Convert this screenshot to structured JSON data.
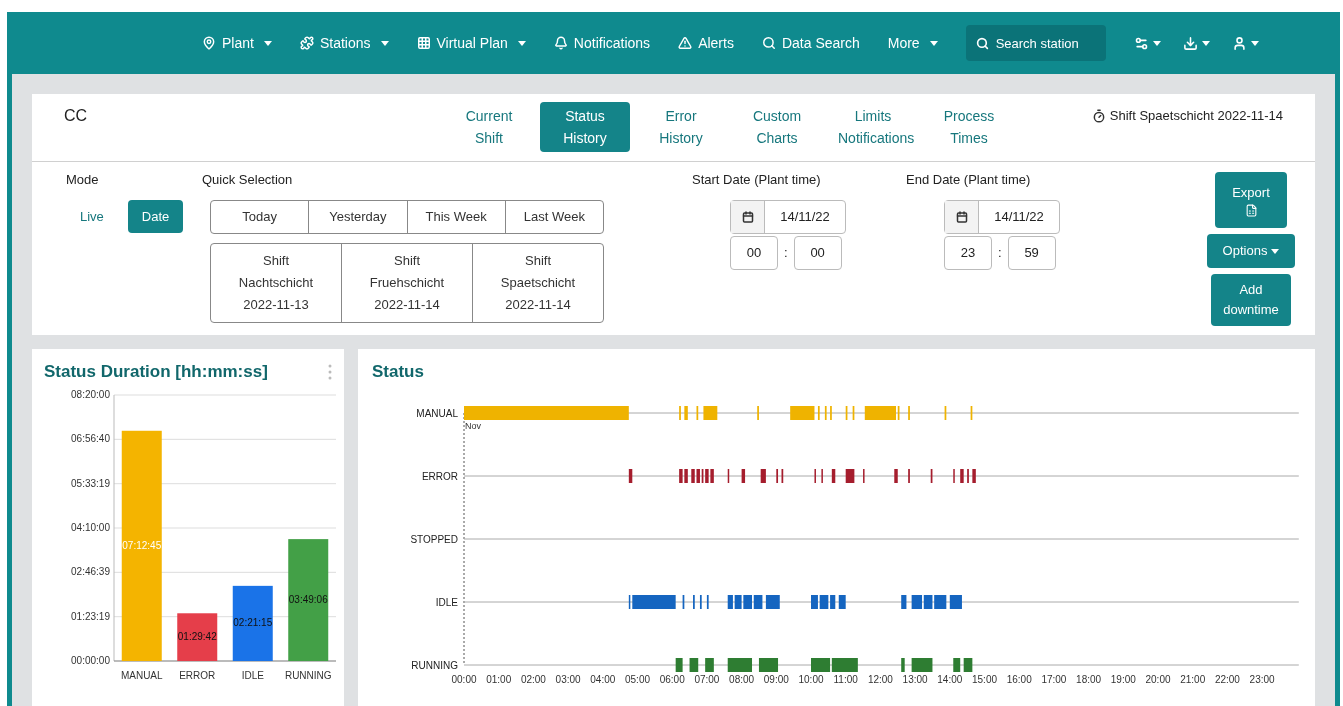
{
  "nav": {
    "items": [
      {
        "label": "Plant",
        "caret": true
      },
      {
        "label": "Stations",
        "caret": true
      },
      {
        "label": "Virtual Plan",
        "caret": true
      },
      {
        "label": "Notifications",
        "caret": false
      },
      {
        "label": "Alerts",
        "caret": false
      },
      {
        "label": "Data Search",
        "caret": false
      },
      {
        "label": "More",
        "caret": true
      }
    ],
    "search": {
      "placeholder": "Search station"
    }
  },
  "header": {
    "title": "CC",
    "tabs": [
      {
        "label": "Current Shift",
        "selected": false
      },
      {
        "label": "Status History",
        "selected": true
      },
      {
        "label": "Error History",
        "selected": false
      },
      {
        "label": "Custom Charts",
        "selected": false
      },
      {
        "label": "Limits Notifications",
        "selected": false
      },
      {
        "label": "Process Times",
        "selected": false
      }
    ],
    "shift": "Shift Spaetschicht 2022-11-14"
  },
  "filters": {
    "mode": {
      "label": "Mode",
      "options": [
        {
          "label": "Live",
          "selected": false
        },
        {
          "label": "Date",
          "selected": true
        }
      ]
    },
    "quick_selection": {
      "label": "Quick Selection",
      "periods": [
        "Today",
        "Yesterday",
        "This Week",
        "Last Week"
      ],
      "shifts": [
        [
          "Shift",
          "Nachtschicht",
          "2022-11-13"
        ],
        [
          "Shift",
          "Fruehschicht",
          "2022-11-14"
        ],
        [
          "Shift",
          "Spaetschicht",
          "2022-11-14"
        ]
      ]
    },
    "ranges": [
      {
        "label": "Start Date (Plant time)",
        "date": "14/11/22",
        "hour": "00",
        "minute": "00",
        "separator": ":"
      },
      {
        "label": "End Date (Plant time)",
        "date": "14/11/22",
        "hour": "23",
        "minute": "59",
        "separator": ":"
      }
    ],
    "actions": [
      {
        "kind": "export",
        "label": "Export"
      },
      {
        "kind": "dropdown",
        "label": "Options"
      },
      {
        "kind": "plain",
        "label": "Add downtime"
      }
    ]
  },
  "duration_card": {
    "title": "Status Duration [hh:mm:ss]",
    "chart_data": {
      "type": "bar",
      "categories": [
        "MANUAL",
        "ERROR",
        "IDLE",
        "RUNNING"
      ],
      "series": [
        {
          "color": "#f4b400",
          "values": [
            25965,
            null,
            null,
            null
          ]
        },
        {
          "color": "#e53e4a",
          "values": [
            null,
            5382,
            null,
            null
          ]
        },
        {
          "color": "#1a73e8",
          "values": [
            null,
            null,
            8475,
            null
          ]
        },
        {
          "color": "#43a047",
          "values": [
            null,
            null,
            null,
            13746
          ]
        }
      ],
      "grid": true,
      "ylim": [
        0,
        30000
      ],
      "yticks": [
        {
          "value": 0,
          "label": "00:00:00"
        },
        {
          "value": 4999,
          "label": "01:23:19"
        },
        {
          "value": 9999,
          "label": "02:46:39"
        },
        {
          "value": 15000,
          "label": "04:10:00"
        },
        {
          "value": 19999,
          "label": "05:33:19"
        },
        {
          "value": 25000,
          "label": "06:56:40"
        },
        {
          "value": 30000,
          "label": "08:20:00"
        }
      ],
      "value_labels": [
        "07:12:45",
        "01:29:42",
        "02:21:15",
        "03:49:06"
      ]
    }
  },
  "status_card": {
    "title": "Status",
    "start_label": "Nov",
    "lanes": [
      {
        "label": "MANUAL",
        "color": "#efb300"
      },
      {
        "label": "ERROR",
        "color": "#a51d2d"
      },
      {
        "label": "STOPPED"
      },
      {
        "label": "IDLE",
        "color": "#1565c0"
      },
      {
        "label": "RUNNING",
        "color": "#2e7d32"
      }
    ],
    "hours": [
      "00:00",
      "01:00",
      "02:00",
      "03:00",
      "04:00",
      "05:00",
      "06:00",
      "07:00",
      "08:00",
      "09:00",
      "10:00",
      "11:00",
      "12:00",
      "13:00",
      "14:00",
      "15:00",
      "16:00",
      "17:00",
      "18:00",
      "19:00",
      "20:00",
      "21:00",
      "22:00",
      "23:00"
    ]
  }
}
